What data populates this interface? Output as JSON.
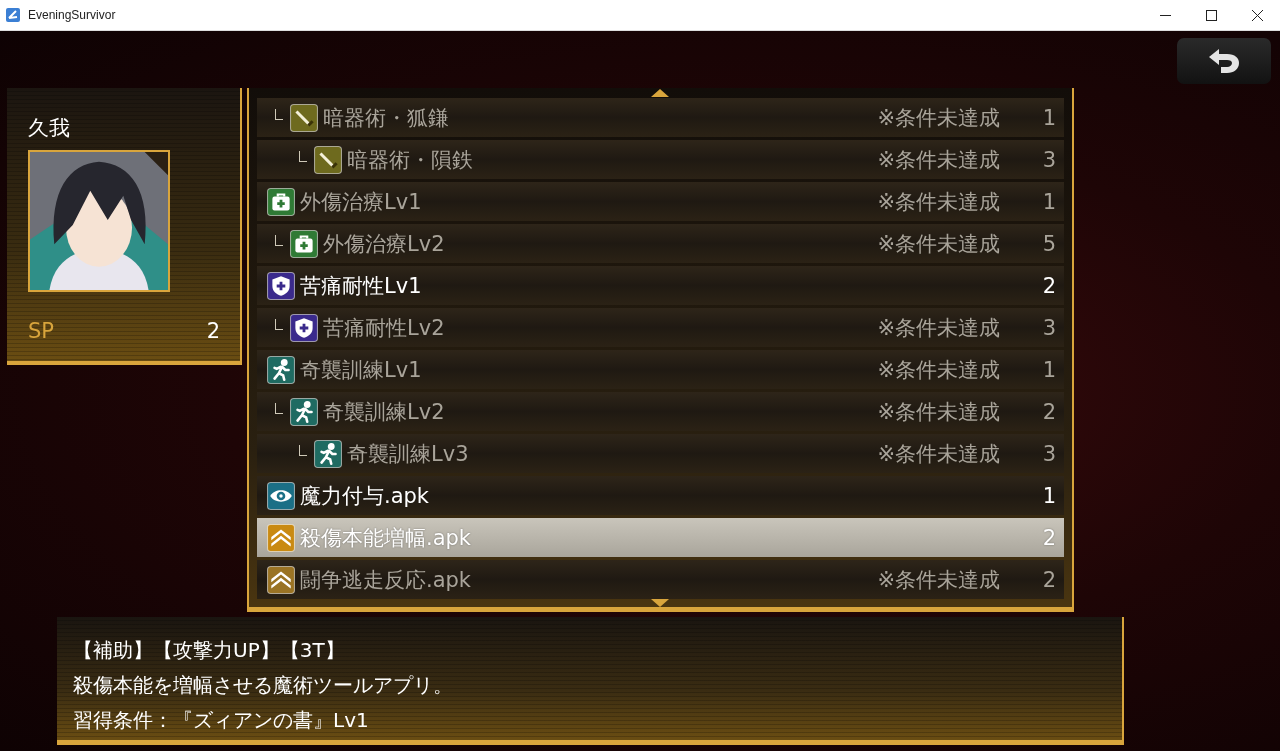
{
  "window": {
    "title": "EveningSurvivor"
  },
  "character": {
    "name": "久我",
    "sp_label": "SP",
    "sp_value": "2"
  },
  "skills": [
    {
      "children": [
        {
          "name": "暗器術・狐鎌",
          "kind": "dagger",
          "color": "#6e6a1e",
          "condition": "※条件未達成",
          "cost": "1",
          "available": false,
          "selected": false,
          "children": [
            {
              "name": "暗器術・隕鉄",
              "kind": "dagger",
              "color": "#6e6a1e",
              "condition": "※条件未達成",
              "cost": "3",
              "available": false,
              "selected": false
            }
          ]
        }
      ]
    },
    {
      "name": "外傷治療Lv1",
      "kind": "medkit",
      "color": "#2f7a35",
      "condition": "※条件未達成",
      "cost": "1",
      "available": false,
      "selected": false,
      "children": [
        {
          "name": "外傷治療Lv2",
          "kind": "medkit",
          "color": "#2f7a35",
          "condition": "※条件未達成",
          "cost": "5",
          "available": false,
          "selected": false
        }
      ]
    },
    {
      "name": "苦痛耐性Lv1",
      "kind": "shield",
      "color": "#3a2a8c",
      "cost": "2",
      "available": true,
      "selected": false,
      "children": [
        {
          "name": "苦痛耐性Lv2",
          "kind": "shield",
          "color": "#3a2a8c",
          "condition": "※条件未達成",
          "cost": "3",
          "available": false,
          "selected": false
        }
      ]
    },
    {
      "name": "奇襲訓練Lv1",
      "kind": "runner",
      "color": "#1f6b62",
      "condition": "※条件未達成",
      "cost": "1",
      "available": false,
      "selected": false,
      "children": [
        {
          "name": "奇襲訓練Lv2",
          "kind": "runner",
          "color": "#1f6b62",
          "condition": "※条件未達成",
          "cost": "2",
          "available": false,
          "selected": false,
          "children": [
            {
              "name": "奇襲訓練Lv3",
              "kind": "runner",
              "color": "#1f6b62",
              "condition": "※条件未達成",
              "cost": "3",
              "available": false,
              "selected": false
            }
          ]
        }
      ]
    },
    {
      "name": "魔力付与.apk",
      "kind": "eye",
      "color": "#1b6f86",
      "cost": "1",
      "available": true,
      "selected": false
    },
    {
      "name": "殺傷本能増幅.apk",
      "kind": "chevrons",
      "color": "#c98a12",
      "cost": "2",
      "available": true,
      "selected": true
    },
    {
      "name": "闘争逃走反応.apk",
      "kind": "chevrons",
      "color": "#9a7324",
      "condition": "※条件未達成",
      "cost": "2",
      "available": false,
      "selected": false
    }
  ],
  "description": [
    "【補助】【攻撃力UP】【3T】",
    "殺傷本能を増幅させる魔術ツールアプリ。",
    "習得条件：『ズィアンの書』Lv1"
  ]
}
